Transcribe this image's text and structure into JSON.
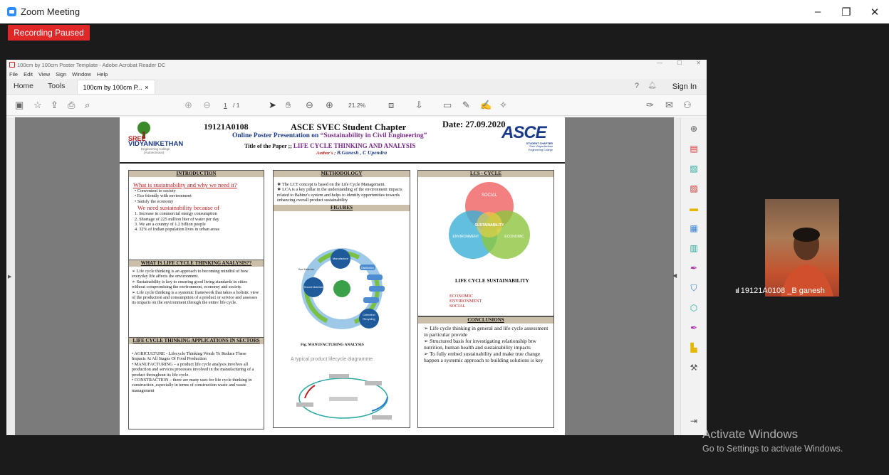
{
  "zoom": {
    "title": "Zoom Meeting",
    "recording": "Recording Paused",
    "participant": "19121A0108 _B ganesh",
    "min": "–",
    "max": "❐",
    "close": "✕"
  },
  "acrobat": {
    "window_title": "100cm by 100cm Poster Template - Adobe Acrobat Reader DC",
    "menu": [
      "File",
      "Edit",
      "View",
      "Sign",
      "Window",
      "Help"
    ],
    "tab_home": "Home",
    "tab_tools": "Tools",
    "doc_tab": "100cm by 100cm P...",
    "doc_tab_close": "×",
    "sign_in": "Sign In",
    "page_current": "1",
    "page_total": "/ 1",
    "zoom": "21.2%"
  },
  "poster": {
    "roll": "19121A0108",
    "chapter": "ASCE SVEC Student Chapter",
    "date": "Date: 27.09.2020",
    "presentation_label": "Online Poster Presentation on ",
    "presentation_topic": "“Sustainability in Civil Engineering”",
    "paper_label": "Title of the Paper ;; ",
    "paper_title": "LIFE CYCLE THINKING AND ANALYSIS",
    "authors_label": "Author's ; ",
    "authors": "B.Ganesh , C Upendra",
    "logo_left_1": "SREE",
    "logo_left_2": "VIDYANIKETHAN",
    "logo_left_3": "Engineering College",
    "logo_left_4": "(Autonomous)",
    "asce": "ASCE",
    "asce_sub1": "STUDENT CHAPTER",
    "asce_sub2": "Sree Vidyanikethan",
    "asce_sub3": "Engineering College",
    "intro_head": "INTRODUCTION",
    "intro_q": "What is sustainability and why we need it?",
    "intro_items": [
      "• Convenient to society",
      "• Eco friendly with environment",
      "• Satisfy the economy"
    ],
    "intro_need": "We need sustainability because of",
    "intro_list": [
      "1. Increase in commercial energy consumption",
      "2. Shortage of 225 million liter of water per day",
      "3. We are a country of 1.2 billion people",
      "4. 32% of Indian population lives in urban areas"
    ],
    "lct_head": "WHAT IS LIFE CYCLE THINKING ANALYSIS??",
    "lct_text": [
      "➢ Life cycle thinking is an approach to becoming mindful of how everyday life affects the environment.",
      "➢ Sustainability is key to ensuring good living standards in cities without compromising the environment, economy and society.",
      "➢ Life cycle thinking is a systemic framework that takes a holistic view of the production and consumption of a product or service and assesses its impacts on the environment through the entire life cycle."
    ],
    "app_head": "LIFE CYCLE THINKING APPLICATIONS IN SECTORS",
    "app_text": [
      "• AGRICULTURE - Lifecycle Thinking Words To Reduce These Impacts At All Stages Of Food Production",
      "• MANUFACTURING – a product life cycle analysis involves all production and services processes involved in the manufacturing of a product throughout its life cycle.",
      "• CONSTRACTION – there are many uses for life cycle thinking in construction ,especially in terms of construction waste and waste management"
    ],
    "meth_head": "METHODOLOGY",
    "meth_text": [
      "❖ The LCT concept is based on the Life Cycle Management.",
      "❖ LCA is a key pillar in the understanding of the environment impacts related to Babine's system and helps to identify opportunities towards enhancing overall product sustainability"
    ],
    "fig_head": "FIGURES",
    "cycle_labels": [
      "Manufacture",
      "Distribution",
      "Recycling",
      "Collection",
      "Second Materials",
      "Raw Materials"
    ],
    "fig_caption": "Fig. MANUFACTURING ANALYSIS",
    "fig2_title": "A typical product lifecycle diagramme",
    "lcs_head": "LCS - CYCLE",
    "venn": {
      "social": "SOCIAL",
      "environment": "ENVIRONMENT",
      "economic": "ECONOMIC",
      "center": "SUSTAINABILITY"
    },
    "lcs_title": "LIFE CYCLE SUSTAINABILITY",
    "lcs_list": [
      "ECONOMIC",
      "ENVIRONMENT",
      "SOCIAL"
    ],
    "concl_head": "CONCLUSIONS",
    "concl_text": [
      "➢ Life cycle thinking in general and life cycle assessment in particular provide",
      "➢ Structured basis for investigating relationship btw nutrition, human health and sustainability impacts",
      "➢ To fully embed sustainability and make true change happen a systemic approach to building solutions is key"
    ]
  },
  "activation": {
    "line1": "Activate Windows",
    "line2": "Go to Settings to activate Windows."
  },
  "colors": {
    "zoom_blue": "#2d8cff",
    "rec_red": "#e02828",
    "poster_blue": "#1a3a8a",
    "poster_purple": "#7b2a8a",
    "poster_red": "#c02020"
  }
}
